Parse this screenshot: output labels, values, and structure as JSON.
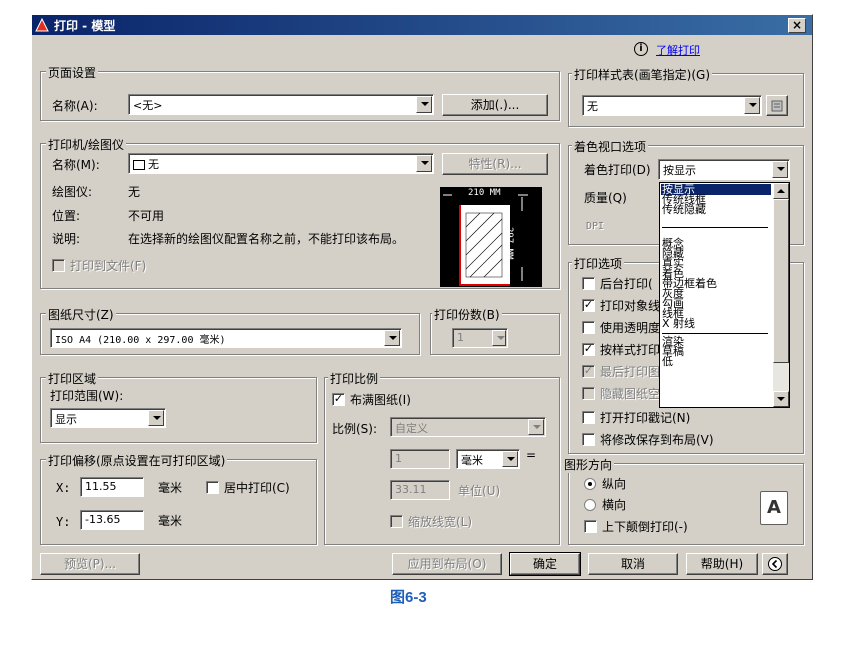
{
  "window": {
    "title": "打印 - 模型",
    "close": "×"
  },
  "help": {
    "link": "了解打印",
    "info_icon": "info-icon"
  },
  "page_setup": {
    "group": "页面设置",
    "name_label": "名称(A):",
    "name_value": "<无>",
    "add_button": "添加(.)..."
  },
  "printer": {
    "group": "打印机/绘图仪",
    "name_label": "名称(M):",
    "name_value": "无",
    "properties_button": "特性(R)...",
    "plotter_label": "绘图仪:",
    "plotter_value": "无",
    "location_label": "位置:",
    "location_value": "不可用",
    "desc_label": "说明:",
    "desc_value": "在选择新的绘图仪配置名称之前，不能打印该布局。",
    "print_to_file": "打印到文件(F)",
    "preview_width": "210 MM",
    "preview_height": "297 MM"
  },
  "paper_size": {
    "group": "图纸尺寸(Z)",
    "value": "ISO A4 (210.00 x 297.00 毫米)"
  },
  "copies": {
    "group": "打印份数(B)",
    "value": "1"
  },
  "plot_area": {
    "group": "打印区域",
    "range_label": "打印范围(W):",
    "range_value": "显示"
  },
  "plot_scale": {
    "group": "打印比例",
    "fit_paper": "布满图纸(I)",
    "scale_label": "比例(S):",
    "scale_value": "自定义",
    "value1": "1",
    "unit1": "毫米",
    "equals": "=",
    "value2": "33.11",
    "unit2": "单位(U)",
    "scale_lineweights": "缩放线宽(L)"
  },
  "plot_offset": {
    "group": "打印偏移(原点设置在可打印区域)",
    "x_label": "X:",
    "x_value": "11.55",
    "x_unit": "毫米",
    "center_plot": "居中打印(C)",
    "y_label": "Y:",
    "y_value": "-13.65",
    "y_unit": "毫米"
  },
  "plot_style_table": {
    "group": "打印样式表(画笔指定)(G)",
    "value": "无"
  },
  "shaded_viewport": {
    "group": "着色视口选项",
    "shade_label": "着色打印(D)",
    "shade_value": "按显示",
    "quality_label": "质量(Q)",
    "dpi_label": "DPI",
    "options": [
      "按显示",
      "传统线框",
      "传统隐藏",
      "概念",
      "隐藏",
      "真实",
      "着色",
      "带边框着色",
      "灰度",
      "勾画",
      "线框",
      "X 射线",
      "渲染",
      "草稿",
      "低"
    ]
  },
  "plot_options": {
    "group": "打印选项",
    "items": [
      "后台打印(",
      "打印对象线",
      "使用透明度",
      "按样式打印",
      "最后打印图",
      "隐藏图纸空",
      "打开打印戳记(N)",
      "将修改保存到布局(V)"
    ],
    "checked": [
      false,
      true,
      false,
      true,
      true,
      false,
      false,
      false
    ]
  },
  "orientation": {
    "group": "图形方向",
    "portrait": "纵向",
    "landscape": "横向",
    "upside_down": "上下颠倒打印(-)",
    "icon_letter": "A"
  },
  "buttons": {
    "preview": "预览(P)...",
    "apply_layout": "应用到布局(O)",
    "ok": "确定",
    "cancel": "取消",
    "help": "帮助(H)"
  },
  "figure_caption": "图6-3",
  "colors": {
    "titlebar_start": "#0a246a",
    "titlebar_end": "#3a6ea5",
    "dialog_bg": "#d4d0c8",
    "selection": "#0a246a",
    "caption": "#1f5fb8"
  }
}
